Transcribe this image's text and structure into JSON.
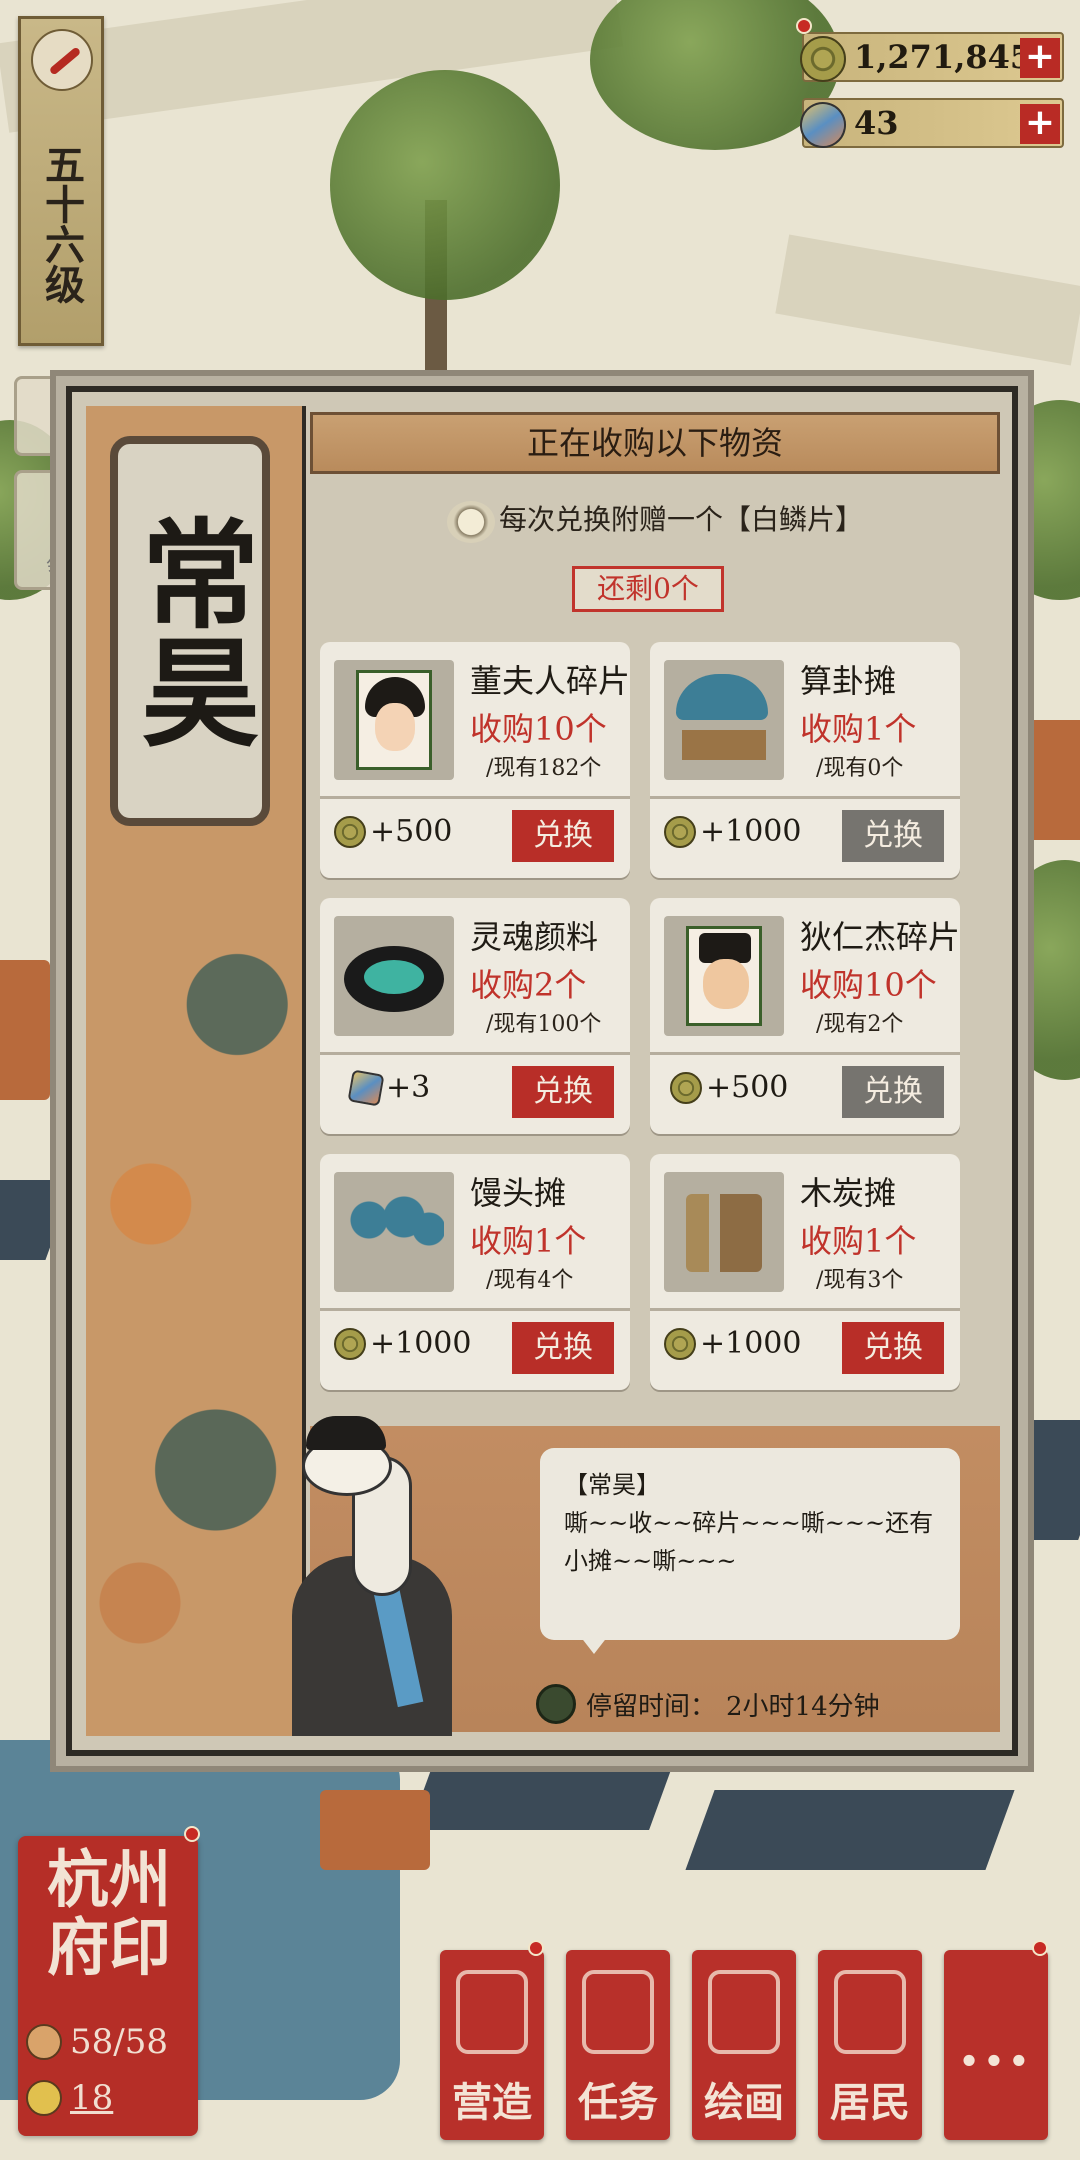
{
  "hud": {
    "level": "五十六级",
    "coins": "1,271,845",
    "gems": "43",
    "plus": "+"
  },
  "side_buttons": [
    {
      "label": ""
    },
    {
      "label": "领"
    }
  ],
  "dialog": {
    "merchant_name": "常昊",
    "header": "正在收购以下物资",
    "bonus_text": "每次兑换附赠一个【白鳞片】",
    "remaining": "还剩0个",
    "items": [
      {
        "title": "董夫人碎片",
        "qty": "收购10个",
        "have": "/现有182个",
        "reward": "+500",
        "reward_icon": "coin-icon",
        "button": "兑换",
        "enabled": true
      },
      {
        "title": "算卦摊",
        "qty": "收购1个",
        "have": "/现有0个",
        "reward": "+1000",
        "reward_icon": "coin-icon",
        "button": "兑换",
        "enabled": false
      },
      {
        "title": "灵魂颜料",
        "qty": "收购2个",
        "have": "/现有100个",
        "reward": "+3",
        "reward_icon": "gem-icon",
        "button": "兑换",
        "enabled": true
      },
      {
        "title": "狄仁杰碎片",
        "qty": "收购10个",
        "have": "/现有2个",
        "reward": "+500",
        "reward_icon": "coin-icon",
        "button": "兑换",
        "enabled": false
      },
      {
        "title": "馒头摊",
        "qty": "收购1个",
        "have": "/现有4个",
        "reward": "+1000",
        "reward_icon": "coin-icon",
        "button": "兑换",
        "enabled": true
      },
      {
        "title": "木炭摊",
        "qty": "收购1个",
        "have": "/现有3个",
        "reward": "+1000",
        "reward_icon": "coin-icon",
        "button": "兑换",
        "enabled": true
      }
    ],
    "speech_name": "【常昊】",
    "speech_text": "嘶~~收~~碎片~~~嘶~~~还有小摊~~嘶~~~",
    "stay_label": "停留时间：",
    "stay_value": "2小时14分钟"
  },
  "seal": {
    "title": "杭州府印",
    "residents": "58/58",
    "gold": "18"
  },
  "menu": [
    {
      "label": "营造"
    },
    {
      "label": "任务"
    },
    {
      "label": "绘画"
    },
    {
      "label": "居民"
    },
    {
      "label": "..."
    }
  ],
  "colors": {
    "accent_red": "#b82e28",
    "disabled_gray": "#76746f",
    "qty_red": "#c0332b"
  }
}
